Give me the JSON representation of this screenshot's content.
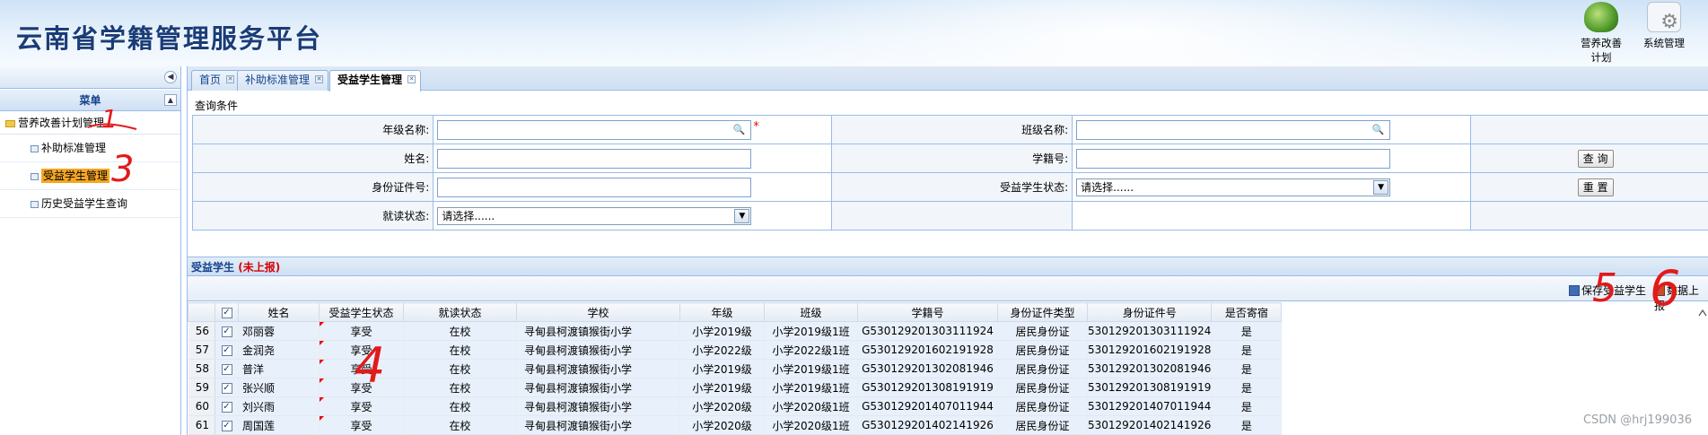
{
  "header": {
    "title": "云南省学籍管理服务平台",
    "icons": [
      {
        "label_line1": "营养改善",
        "label_line2": "计划",
        "icon": "nutrition-plan-icon"
      },
      {
        "label_line1": "系统管理",
        "label_line2": "",
        "icon": "system-settings-icon"
      }
    ]
  },
  "sidebar": {
    "menu_title": "菜单",
    "group": "营养改善计划管理",
    "items": [
      {
        "label": "补助标准管理",
        "active": false
      },
      {
        "label": "受益学生管理",
        "active": true
      },
      {
        "label": "历史受益学生查询",
        "active": false
      }
    ]
  },
  "tabs": [
    {
      "label": "首页",
      "active": false
    },
    {
      "label": "补助标准管理",
      "active": false
    },
    {
      "label": "受益学生管理",
      "active": true
    }
  ],
  "query": {
    "section_label": "查询条件",
    "grade_name_label": "年级名称:",
    "class_name_label": "班级名称:",
    "name_label": "姓名:",
    "student_no_label": "学籍号:",
    "id_no_label": "身份证件号:",
    "benefit_status_label": "受益学生状态:",
    "benefit_status_value": "请选择......",
    "study_status_label": "就读状态:",
    "study_status_value": "请选择......",
    "search_button": "查 询",
    "reset_button": "重 置",
    "required_mark": "*"
  },
  "results": {
    "title": "受益学生",
    "status": "(未上报)",
    "save_button": "保存受益学生",
    "upload_button": "数据上报",
    "columns": [
      "姓名",
      "受益学生状态",
      "就读状态",
      "学校",
      "年级",
      "班级",
      "学籍号",
      "身份证件类型",
      "身份证件号",
      "是否寄宿"
    ],
    "rows": [
      {
        "rn": "56",
        "name": "邓丽蓉",
        "benefit": "享受",
        "study": "在校",
        "school": "寻甸县柯渡镇猴街小学",
        "grade": "小学2019级",
        "class": "小学2019级1班",
        "student_no": "G530129201303111924",
        "id_type": "居民身份证",
        "id_no": "530129201303111924",
        "boarding": "是"
      },
      {
        "rn": "57",
        "name": "金润尧",
        "benefit": "享受",
        "study": "在校",
        "school": "寻甸县柯渡镇猴街小学",
        "grade": "小学2022级",
        "class": "小学2022级1班",
        "student_no": "G530129201602191928",
        "id_type": "居民身份证",
        "id_no": "530129201602191928",
        "boarding": "是"
      },
      {
        "rn": "58",
        "name": "普洋",
        "benefit": "享受",
        "study": "在校",
        "school": "寻甸县柯渡镇猴街小学",
        "grade": "小学2019级",
        "class": "小学2019级1班",
        "student_no": "G530129201302081946",
        "id_type": "居民身份证",
        "id_no": "530129201302081946",
        "boarding": "是"
      },
      {
        "rn": "59",
        "name": "张兴顺",
        "benefit": "享受",
        "study": "在校",
        "school": "寻甸县柯渡镇猴街小学",
        "grade": "小学2019级",
        "class": "小学2019级1班",
        "student_no": "G530129201308191919",
        "id_type": "居民身份证",
        "id_no": "530129201308191919",
        "boarding": "是"
      },
      {
        "rn": "60",
        "name": "刘兴雨",
        "benefit": "享受",
        "study": "在校",
        "school": "寻甸县柯渡镇猴街小学",
        "grade": "小学2020级",
        "class": "小学2020级1班",
        "student_no": "G530129201407011944",
        "id_type": "居民身份证",
        "id_no": "530129201407011944",
        "boarding": "是"
      },
      {
        "rn": "61",
        "name": "周国莲",
        "benefit": "享受",
        "study": "在校",
        "school": "寻甸县柯渡镇猴街小学",
        "grade": "小学2020级",
        "class": "小学2020级1班",
        "student_no": "G530129201402141926",
        "id_type": "居民身份证",
        "id_no": "530129201402141926",
        "boarding": "是"
      }
    ]
  },
  "annotations": [
    "1",
    "3",
    "4",
    "5",
    "6"
  ],
  "watermark": "CSDN @hrj199036"
}
